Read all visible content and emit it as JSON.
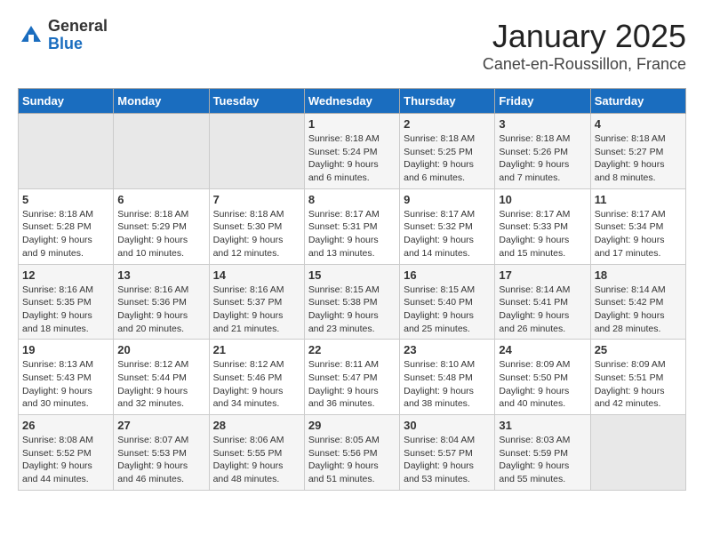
{
  "header": {
    "logo_general": "General",
    "logo_blue": "Blue",
    "month_title": "January 2025",
    "location": "Canet-en-Roussillon, France"
  },
  "weekdays": [
    "Sunday",
    "Monday",
    "Tuesday",
    "Wednesday",
    "Thursday",
    "Friday",
    "Saturday"
  ],
  "weeks": [
    [
      {
        "day": "",
        "sunrise": "",
        "sunset": "",
        "daylight": "",
        "empty": true
      },
      {
        "day": "",
        "sunrise": "",
        "sunset": "",
        "daylight": "",
        "empty": true
      },
      {
        "day": "",
        "sunrise": "",
        "sunset": "",
        "daylight": "",
        "empty": true
      },
      {
        "day": "1",
        "sunrise": "Sunrise: 8:18 AM",
        "sunset": "Sunset: 5:24 PM",
        "daylight": "Daylight: 9 hours and 6 minutes."
      },
      {
        "day": "2",
        "sunrise": "Sunrise: 8:18 AM",
        "sunset": "Sunset: 5:25 PM",
        "daylight": "Daylight: 9 hours and 6 minutes."
      },
      {
        "day": "3",
        "sunrise": "Sunrise: 8:18 AM",
        "sunset": "Sunset: 5:26 PM",
        "daylight": "Daylight: 9 hours and 7 minutes."
      },
      {
        "day": "4",
        "sunrise": "Sunrise: 8:18 AM",
        "sunset": "Sunset: 5:27 PM",
        "daylight": "Daylight: 9 hours and 8 minutes."
      }
    ],
    [
      {
        "day": "5",
        "sunrise": "Sunrise: 8:18 AM",
        "sunset": "Sunset: 5:28 PM",
        "daylight": "Daylight: 9 hours and 9 minutes."
      },
      {
        "day": "6",
        "sunrise": "Sunrise: 8:18 AM",
        "sunset": "Sunset: 5:29 PM",
        "daylight": "Daylight: 9 hours and 10 minutes."
      },
      {
        "day": "7",
        "sunrise": "Sunrise: 8:18 AM",
        "sunset": "Sunset: 5:30 PM",
        "daylight": "Daylight: 9 hours and 12 minutes."
      },
      {
        "day": "8",
        "sunrise": "Sunrise: 8:17 AM",
        "sunset": "Sunset: 5:31 PM",
        "daylight": "Daylight: 9 hours and 13 minutes."
      },
      {
        "day": "9",
        "sunrise": "Sunrise: 8:17 AM",
        "sunset": "Sunset: 5:32 PM",
        "daylight": "Daylight: 9 hours and 14 minutes."
      },
      {
        "day": "10",
        "sunrise": "Sunrise: 8:17 AM",
        "sunset": "Sunset: 5:33 PM",
        "daylight": "Daylight: 9 hours and 15 minutes."
      },
      {
        "day": "11",
        "sunrise": "Sunrise: 8:17 AM",
        "sunset": "Sunset: 5:34 PM",
        "daylight": "Daylight: 9 hours and 17 minutes."
      }
    ],
    [
      {
        "day": "12",
        "sunrise": "Sunrise: 8:16 AM",
        "sunset": "Sunset: 5:35 PM",
        "daylight": "Daylight: 9 hours and 18 minutes."
      },
      {
        "day": "13",
        "sunrise": "Sunrise: 8:16 AM",
        "sunset": "Sunset: 5:36 PM",
        "daylight": "Daylight: 9 hours and 20 minutes."
      },
      {
        "day": "14",
        "sunrise": "Sunrise: 8:16 AM",
        "sunset": "Sunset: 5:37 PM",
        "daylight": "Daylight: 9 hours and 21 minutes."
      },
      {
        "day": "15",
        "sunrise": "Sunrise: 8:15 AM",
        "sunset": "Sunset: 5:38 PM",
        "daylight": "Daylight: 9 hours and 23 minutes."
      },
      {
        "day": "16",
        "sunrise": "Sunrise: 8:15 AM",
        "sunset": "Sunset: 5:40 PM",
        "daylight": "Daylight: 9 hours and 25 minutes."
      },
      {
        "day": "17",
        "sunrise": "Sunrise: 8:14 AM",
        "sunset": "Sunset: 5:41 PM",
        "daylight": "Daylight: 9 hours and 26 minutes."
      },
      {
        "day": "18",
        "sunrise": "Sunrise: 8:14 AM",
        "sunset": "Sunset: 5:42 PM",
        "daylight": "Daylight: 9 hours and 28 minutes."
      }
    ],
    [
      {
        "day": "19",
        "sunrise": "Sunrise: 8:13 AM",
        "sunset": "Sunset: 5:43 PM",
        "daylight": "Daylight: 9 hours and 30 minutes."
      },
      {
        "day": "20",
        "sunrise": "Sunrise: 8:12 AM",
        "sunset": "Sunset: 5:44 PM",
        "daylight": "Daylight: 9 hours and 32 minutes."
      },
      {
        "day": "21",
        "sunrise": "Sunrise: 8:12 AM",
        "sunset": "Sunset: 5:46 PM",
        "daylight": "Daylight: 9 hours and 34 minutes."
      },
      {
        "day": "22",
        "sunrise": "Sunrise: 8:11 AM",
        "sunset": "Sunset: 5:47 PM",
        "daylight": "Daylight: 9 hours and 36 minutes."
      },
      {
        "day": "23",
        "sunrise": "Sunrise: 8:10 AM",
        "sunset": "Sunset: 5:48 PM",
        "daylight": "Daylight: 9 hours and 38 minutes."
      },
      {
        "day": "24",
        "sunrise": "Sunrise: 8:09 AM",
        "sunset": "Sunset: 5:50 PM",
        "daylight": "Daylight: 9 hours and 40 minutes."
      },
      {
        "day": "25",
        "sunrise": "Sunrise: 8:09 AM",
        "sunset": "Sunset: 5:51 PM",
        "daylight": "Daylight: 9 hours and 42 minutes."
      }
    ],
    [
      {
        "day": "26",
        "sunrise": "Sunrise: 8:08 AM",
        "sunset": "Sunset: 5:52 PM",
        "daylight": "Daylight: 9 hours and 44 minutes."
      },
      {
        "day": "27",
        "sunrise": "Sunrise: 8:07 AM",
        "sunset": "Sunset: 5:53 PM",
        "daylight": "Daylight: 9 hours and 46 minutes."
      },
      {
        "day": "28",
        "sunrise": "Sunrise: 8:06 AM",
        "sunset": "Sunset: 5:55 PM",
        "daylight": "Daylight: 9 hours and 48 minutes."
      },
      {
        "day": "29",
        "sunrise": "Sunrise: 8:05 AM",
        "sunset": "Sunset: 5:56 PM",
        "daylight": "Daylight: 9 hours and 51 minutes."
      },
      {
        "day": "30",
        "sunrise": "Sunrise: 8:04 AM",
        "sunset": "Sunset: 5:57 PM",
        "daylight": "Daylight: 9 hours and 53 minutes."
      },
      {
        "day": "31",
        "sunrise": "Sunrise: 8:03 AM",
        "sunset": "Sunset: 5:59 PM",
        "daylight": "Daylight: 9 hours and 55 minutes."
      },
      {
        "day": "",
        "sunrise": "",
        "sunset": "",
        "daylight": "",
        "empty": true
      }
    ]
  ]
}
